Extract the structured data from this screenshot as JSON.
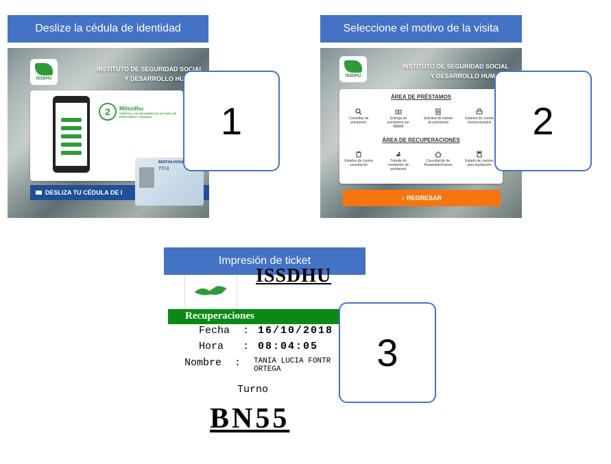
{
  "steps": [
    {
      "label": "Deslize la cédula de identidad",
      "number": "1"
    },
    {
      "label": "Seleccione el motivo de la visita",
      "number": "2"
    },
    {
      "label": "Impresión de ticket",
      "number": "3"
    }
  ],
  "kiosk": {
    "logo_text": "ISSDHU",
    "institute_line1": "INSTITUTO DE SEGURIDAD SOCIAL",
    "institute_line2": "Y DESARROLLO HUMANO",
    "step2_badge": "2",
    "app_name": "MiIssdhu",
    "app_caption": "VERIFICA LOS MOVIMIENTOS DE PAGO DE PRÉSTAMOS Y FIANZAS",
    "swipe_bar": "DESLIZA TU CÉDULA DE I",
    "id_card_name": "BERTHA ROSA",
    "id_card_number": "777-0"
  },
  "menu": {
    "loans_title": "ÁREA DE PRÉSTAMOS",
    "loans_options": [
      {
        "label": "Consultas de préstamos",
        "icon": "search-icon"
      },
      {
        "label": "Entrega de préstamos por BBMM",
        "icon": "cash-icon"
      },
      {
        "label": "Solicitud de trámite de préstamos",
        "icon": "document-icon"
      },
      {
        "label": "Estados de cuenta reestructurados",
        "icon": "printer-icon"
      }
    ],
    "recovery_title": "ÁREA DE RECUPERACIONES",
    "recovery_options": [
      {
        "label": "Estados de cuenta cancelación",
        "icon": "clipboard-icon"
      },
      {
        "label": "Trámite de reembolso de préstamos",
        "icon": "hand-icon"
      },
      {
        "label": "Cancelación de Repatriado/Fianza",
        "icon": "home-icon"
      },
      {
        "label": "Estado de cuentas para liquidación",
        "icon": "calculator-icon"
      }
    ],
    "back_button": "REGRESAR",
    "back_icon": "chevron-left-icon"
  },
  "ticket": {
    "brand": "ISSDHU",
    "section": "Recuperaciones",
    "fecha_label": "Fecha",
    "fecha_value": "16/10/2018",
    "hora_label": "Hora",
    "hora_value": "08:04:05",
    "nombre_label": "Nombre",
    "nombre_value_line1": "TANIA LUCIA FONTR",
    "nombre_value_line2": "ORTEGA",
    "turno_label": "Turno",
    "turno_value": "BN55"
  },
  "colors": {
    "label_bg": "#4472c4",
    "brand_green": "#2e9b3a",
    "orange": "#f5760f",
    "swipe_blue": "#1f4f96"
  }
}
